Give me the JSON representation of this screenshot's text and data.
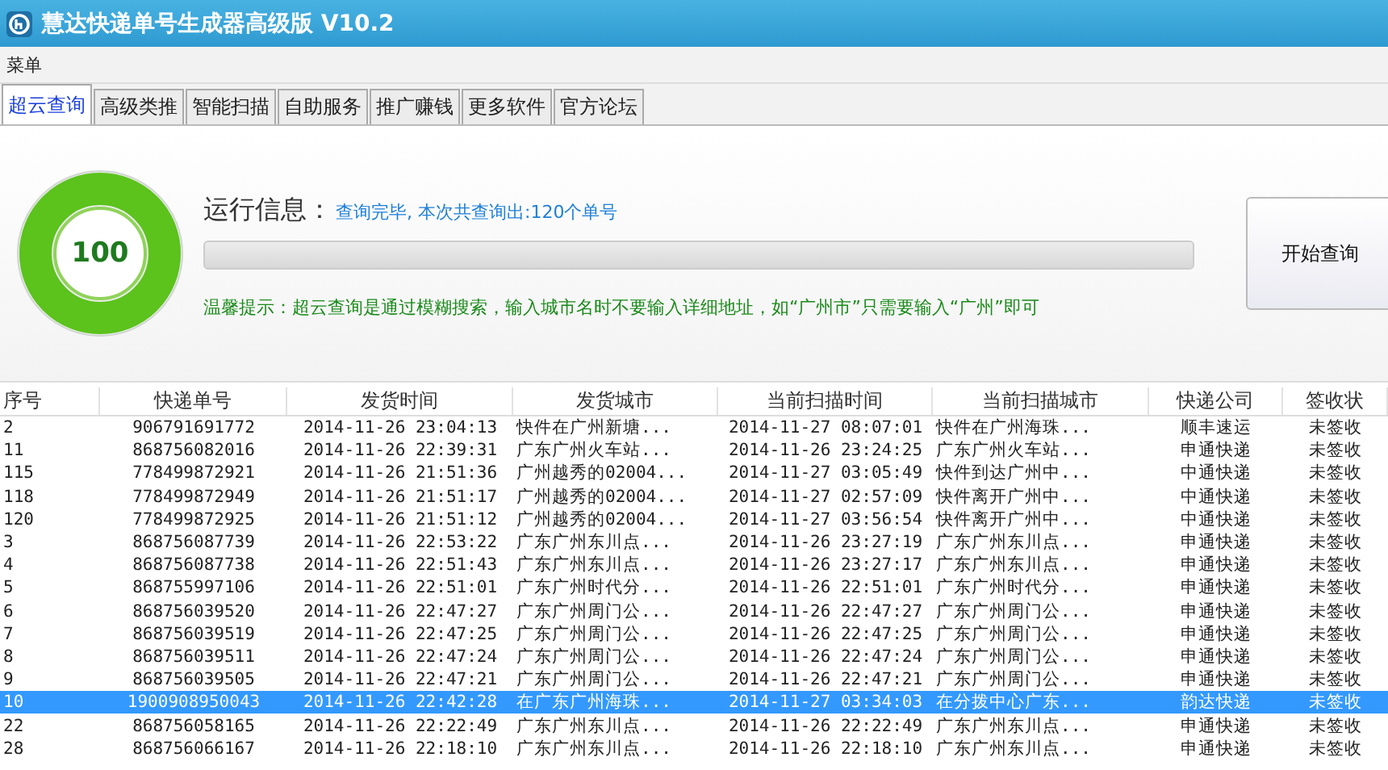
{
  "window": {
    "title": "慧达快递单号生成器高级版 V10.2"
  },
  "menu": [
    "菜单"
  ],
  "tabs": [
    {
      "label": "超云查询",
      "selected": true
    },
    {
      "label": "高级类推",
      "selected": false
    },
    {
      "label": "智能扫描",
      "selected": false
    },
    {
      "label": "自助服务",
      "selected": false
    },
    {
      "label": "推广赚钱",
      "selected": false
    },
    {
      "label": "更多软件",
      "selected": false
    },
    {
      "label": "官方论坛",
      "selected": false
    }
  ],
  "gauge": {
    "value": "100",
    "level": 1
  },
  "status": {
    "label": "运行信息：",
    "message": "查询完毕, 本次共查询出:120个单号"
  },
  "progress": {
    "level": 0
  },
  "hint": "温馨提示：超云查询是通过模糊搜索，输入城市名时不要输入详细地址，如“广州市”只需要输入“广州”即可",
  "start_button": "开始查询",
  "table": {
    "columns": [
      "序号",
      "快递单号",
      "发货时间",
      "发货城市",
      "当前扫描时间",
      "当前扫描城市",
      "快递公司",
      "签收状"
    ],
    "rows": [
      {
        "selected": false,
        "cells": [
          "2",
          "906791691772",
          "2014-11-26 23:04:13",
          "快件在广州新塘...",
          "2014-11-27 08:07:01",
          "快件在广州海珠...",
          "顺丰速运",
          "未签收"
        ]
      },
      {
        "selected": false,
        "cells": [
          "11",
          "868756082016",
          "2014-11-26 22:39:31",
          "广东广州火车站...",
          "2014-11-26 23:24:25",
          "广东广州火车站...",
          "申通快递",
          "未签收"
        ]
      },
      {
        "selected": false,
        "cells": [
          "115",
          "778499872921",
          "2014-11-26 21:51:36",
          "广州越秀的02004...",
          "2014-11-27 03:05:49",
          "快件到达广州中...",
          "中通快递",
          "未签收"
        ]
      },
      {
        "selected": false,
        "cells": [
          "118",
          "778499872949",
          "2014-11-26 21:51:17",
          "广州越秀的02004...",
          "2014-11-27 02:57:09",
          "快件离开广州中...",
          "中通快递",
          "未签收"
        ]
      },
      {
        "selected": false,
        "cells": [
          "120",
          "778499872925",
          "2014-11-26 21:51:12",
          "广州越秀的02004...",
          "2014-11-27 03:56:54",
          "快件离开广州中...",
          "中通快递",
          "未签收"
        ]
      },
      {
        "selected": false,
        "cells": [
          "3",
          "868756087739",
          "2014-11-26 22:53:22",
          "广东广州东川点...",
          "2014-11-26 23:27:19",
          "广东广州东川点...",
          "申通快递",
          "未签收"
        ]
      },
      {
        "selected": false,
        "cells": [
          "4",
          "868756087738",
          "2014-11-26 22:51:43",
          "广东广州东川点...",
          "2014-11-26 23:27:17",
          "广东广州东川点...",
          "申通快递",
          "未签收"
        ]
      },
      {
        "selected": false,
        "cells": [
          "5",
          "868755997106",
          "2014-11-26 22:51:01",
          "广东广州时代分...",
          "2014-11-26 22:51:01",
          "广东广州时代分...",
          "申通快递",
          "未签收"
        ]
      },
      {
        "selected": false,
        "cells": [
          "6",
          "868756039520",
          "2014-11-26 22:47:27",
          "广东广州周门公...",
          "2014-11-26 22:47:27",
          "广东广州周门公...",
          "申通快递",
          "未签收"
        ]
      },
      {
        "selected": false,
        "cells": [
          "7",
          "868756039519",
          "2014-11-26 22:47:25",
          "广东广州周门公...",
          "2014-11-26 22:47:25",
          "广东广州周门公...",
          "申通快递",
          "未签收"
        ]
      },
      {
        "selected": false,
        "cells": [
          "8",
          "868756039511",
          "2014-11-26 22:47:24",
          "广东广州周门公...",
          "2014-11-26 22:47:24",
          "广东广州周门公...",
          "申通快递",
          "未签收"
        ]
      },
      {
        "selected": false,
        "cells": [
          "9",
          "868756039505",
          "2014-11-26 22:47:21",
          "广东广州周门公...",
          "2014-11-26 22:47:21",
          "广东广州周门公...",
          "申通快递",
          "未签收"
        ]
      },
      {
        "selected": true,
        "cells": [
          "10",
          "1900908950043",
          "2014-11-26 22:42:28",
          "在广东广州海珠...",
          "2014-11-27 03:34:03",
          "在分拨中心广东...",
          "韵达快递",
          "未签收"
        ]
      },
      {
        "selected": false,
        "cells": [
          "22",
          "868756058165",
          "2014-11-26 22:22:49",
          "广东广州东川点...",
          "2014-11-26 22:22:49",
          "广东广州东川点...",
          "申通快递",
          "未签收"
        ]
      },
      {
        "selected": false,
        "cells": [
          "28",
          "868756066167",
          "2014-11-26 22:18:10",
          "广东广州东川点...",
          "2014-11-26 22:18:10",
          "广东广州东川点...",
          "申通快递",
          "未签收"
        ]
      }
    ]
  }
}
